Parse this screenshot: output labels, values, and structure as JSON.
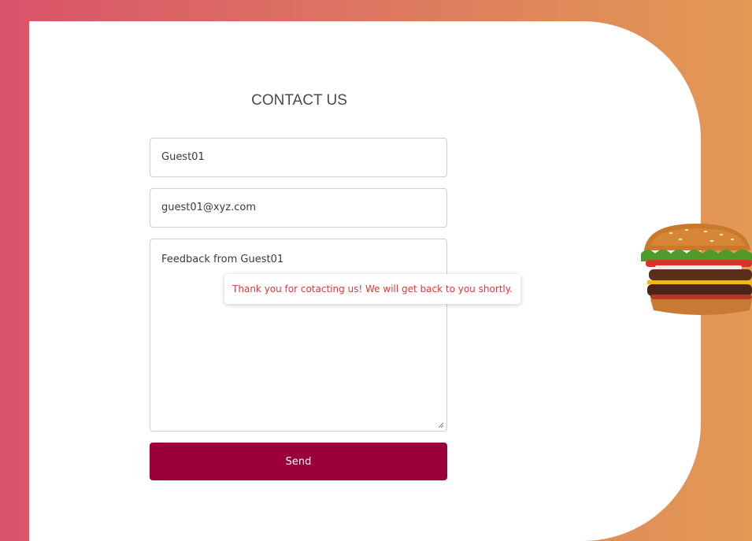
{
  "form": {
    "title": "CONTACT US",
    "name_value": "Guest01",
    "email_value": "guest01@xyz.com",
    "message_value": "Feedback from Guest01",
    "send_label": "Send"
  },
  "tooltip": {
    "message": "Thank you for cotacting us! We will get back to you shortly."
  },
  "colors": {
    "background_left": "#d9536a",
    "background_right": "#e39a55",
    "send_button": "#9c0039",
    "tooltip_text": "#d93a3a"
  },
  "icons": [
    "burger-image",
    "resize-handle-icon"
  ]
}
